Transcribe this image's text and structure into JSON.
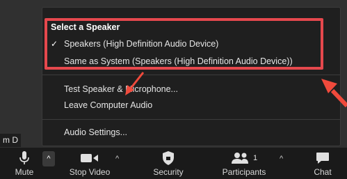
{
  "menu": {
    "header": "Select a Speaker",
    "speaker_selected": "Speakers (High Definition Audio Device)",
    "speaker_same_as_system": "Same as System (Speakers (High Definition Audio Device))",
    "test_item": "Test Speaker & Microphone...",
    "leave_item": "Leave Computer Audio",
    "settings_item": "Audio Settings...",
    "check_glyph": "✓"
  },
  "participant_name": "m D",
  "toolbar": {
    "mute": "Mute",
    "stop_video": "Stop Video",
    "security": "Security",
    "participants": "Participants",
    "participants_count": "1",
    "chat": "Chat"
  },
  "colors": {
    "highlight": "#e5484d",
    "menu_bg": "#1f1f1f",
    "toolbar_bg": "#1a1a1a"
  }
}
